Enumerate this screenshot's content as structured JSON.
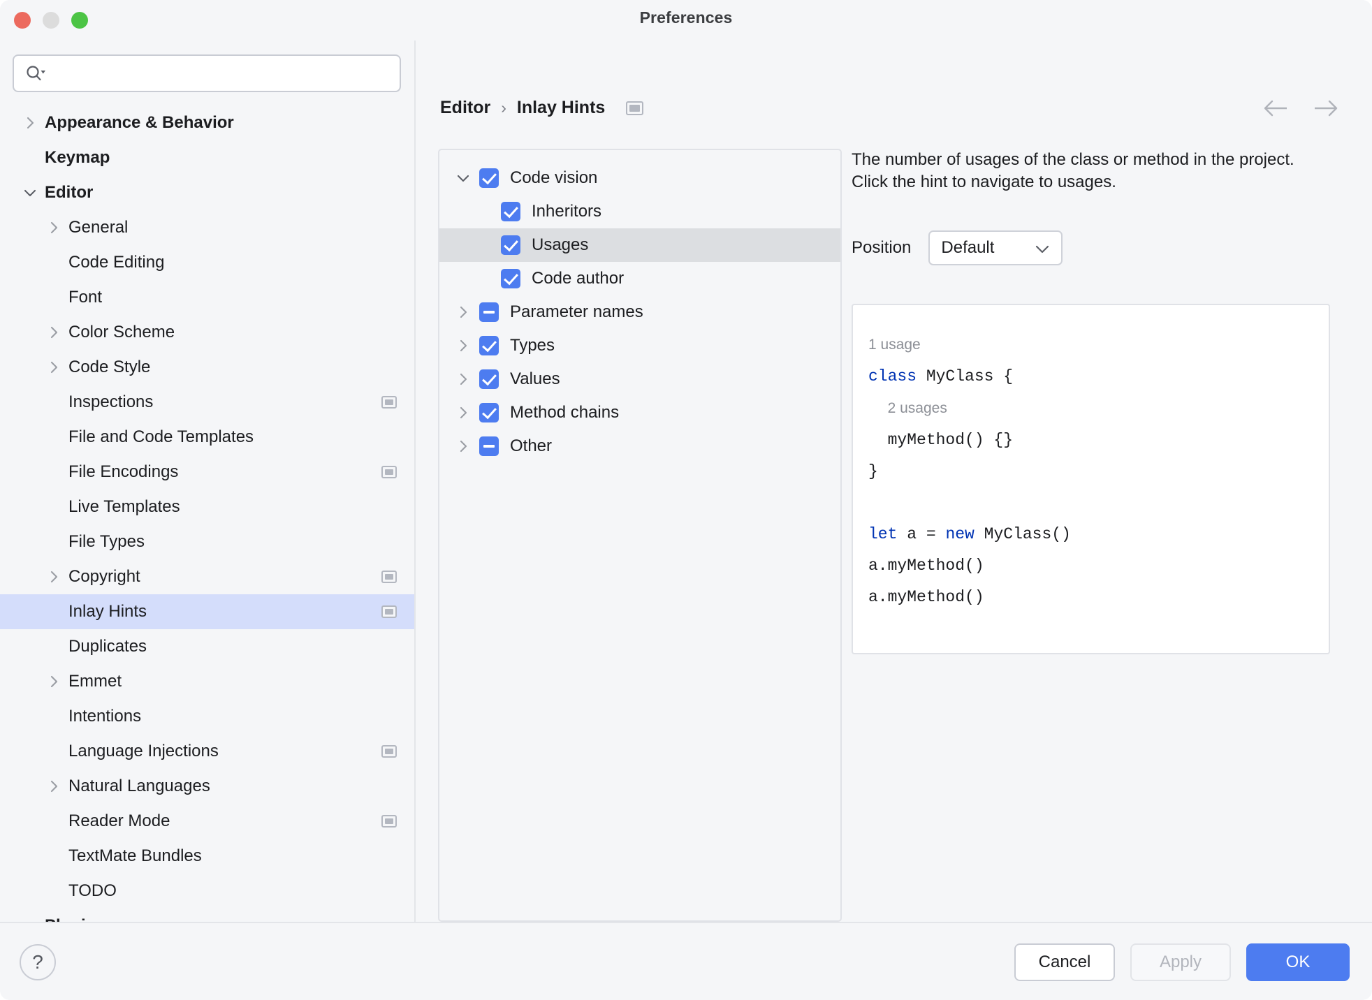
{
  "window": {
    "title": "Preferences",
    "traffic_lights": [
      "close-red",
      "minimize-yellow",
      "maximize-green"
    ]
  },
  "search": {
    "value": "",
    "placeholder": "",
    "icon": "search-icon"
  },
  "sidebar": {
    "items": [
      {
        "label": "Appearance & Behavior",
        "level": 0,
        "twisty": "right",
        "bold": true,
        "badge": false,
        "selected": false
      },
      {
        "label": "Keymap",
        "level": 0,
        "twisty": "none",
        "bold": true,
        "badge": false,
        "selected": false
      },
      {
        "label": "Editor",
        "level": 0,
        "twisty": "down",
        "bold": true,
        "badge": false,
        "selected": false
      },
      {
        "label": "General",
        "level": 1,
        "twisty": "right",
        "bold": false,
        "badge": false,
        "selected": false
      },
      {
        "label": "Code Editing",
        "level": 1,
        "twisty": "none",
        "bold": false,
        "badge": false,
        "selected": false
      },
      {
        "label": "Font",
        "level": 1,
        "twisty": "none",
        "bold": false,
        "badge": false,
        "selected": false
      },
      {
        "label": "Color Scheme",
        "level": 1,
        "twisty": "right",
        "bold": false,
        "badge": false,
        "selected": false
      },
      {
        "label": "Code Style",
        "level": 1,
        "twisty": "right",
        "bold": false,
        "badge": false,
        "selected": false
      },
      {
        "label": "Inspections",
        "level": 1,
        "twisty": "none",
        "bold": false,
        "badge": true,
        "selected": false
      },
      {
        "label": "File and Code Templates",
        "level": 1,
        "twisty": "none",
        "bold": false,
        "badge": false,
        "selected": false
      },
      {
        "label": "File Encodings",
        "level": 1,
        "twisty": "none",
        "bold": false,
        "badge": true,
        "selected": false
      },
      {
        "label": "Live Templates",
        "level": 1,
        "twisty": "none",
        "bold": false,
        "badge": false,
        "selected": false
      },
      {
        "label": "File Types",
        "level": 1,
        "twisty": "none",
        "bold": false,
        "badge": false,
        "selected": false
      },
      {
        "label": "Copyright",
        "level": 1,
        "twisty": "right",
        "bold": false,
        "badge": true,
        "selected": false
      },
      {
        "label": "Inlay Hints",
        "level": 1,
        "twisty": "none",
        "bold": false,
        "badge": true,
        "selected": true
      },
      {
        "label": "Duplicates",
        "level": 1,
        "twisty": "none",
        "bold": false,
        "badge": false,
        "selected": false
      },
      {
        "label": "Emmet",
        "level": 1,
        "twisty": "right",
        "bold": false,
        "badge": false,
        "selected": false
      },
      {
        "label": "Intentions",
        "level": 1,
        "twisty": "none",
        "bold": false,
        "badge": false,
        "selected": false
      },
      {
        "label": "Language Injections",
        "level": 1,
        "twisty": "none",
        "bold": false,
        "badge": true,
        "selected": false
      },
      {
        "label": "Natural Languages",
        "level": 1,
        "twisty": "right",
        "bold": false,
        "badge": false,
        "selected": false
      },
      {
        "label": "Reader Mode",
        "level": 1,
        "twisty": "none",
        "bold": false,
        "badge": true,
        "selected": false
      },
      {
        "label": "TextMate Bundles",
        "level": 1,
        "twisty": "none",
        "bold": false,
        "badge": false,
        "selected": false
      },
      {
        "label": "TODO",
        "level": 1,
        "twisty": "none",
        "bold": false,
        "badge": false,
        "selected": false
      },
      {
        "label": "Plugins",
        "level": 0,
        "twisty": "none",
        "bold": true,
        "badge": false,
        "selected": false
      }
    ]
  },
  "breadcrumb": {
    "parent": "Editor",
    "separator": "›",
    "current": "Inlay Hints",
    "badge_icon": "project-scope-badge-icon"
  },
  "nav": {
    "back_icon": "arrow-left-icon",
    "forward_icon": "arrow-right-icon"
  },
  "options_tree": {
    "items": [
      {
        "label": "Code vision",
        "depth": 0,
        "twisty": "down",
        "check": "checked",
        "selected": false
      },
      {
        "label": "Inheritors",
        "depth": 1,
        "twisty": "none",
        "check": "checked",
        "selected": false
      },
      {
        "label": "Usages",
        "depth": 1,
        "twisty": "none",
        "check": "checked",
        "selected": true
      },
      {
        "label": "Code author",
        "depth": 1,
        "twisty": "none",
        "check": "checked",
        "selected": false
      },
      {
        "label": "Parameter names",
        "depth": 0,
        "twisty": "right",
        "check": "indeterminate",
        "selected": false
      },
      {
        "label": "Types",
        "depth": 0,
        "twisty": "right",
        "check": "checked",
        "selected": false
      },
      {
        "label": "Values",
        "depth": 0,
        "twisty": "right",
        "check": "checked",
        "selected": false
      },
      {
        "label": "Method chains",
        "depth": 0,
        "twisty": "right",
        "check": "checked",
        "selected": false
      },
      {
        "label": "Other",
        "depth": 0,
        "twisty": "right",
        "check": "indeterminate",
        "selected": false
      }
    ]
  },
  "detail": {
    "description": "The number of usages of the class or method in the project. Click the hint to navigate to usages.",
    "position_label": "Position",
    "position_value": "Default",
    "position_options": [
      "Default"
    ],
    "dropdown_icon": "chevron-down-icon"
  },
  "code_preview": {
    "lines": [
      {
        "indent": 0,
        "type": "hint",
        "text": "1 usage"
      },
      {
        "indent": 0,
        "type": "code",
        "segments": [
          {
            "t": "class",
            "c": "kw"
          },
          {
            "t": " MyClass {",
            "c": ""
          }
        ]
      },
      {
        "indent": 1,
        "type": "hint",
        "text": "2 usages"
      },
      {
        "indent": 1,
        "type": "code",
        "segments": [
          {
            "t": "myMethod() {}",
            "c": ""
          }
        ]
      },
      {
        "indent": 0,
        "type": "code",
        "segments": [
          {
            "t": "}",
            "c": ""
          }
        ]
      },
      {
        "indent": 0,
        "type": "code",
        "segments": [
          {
            "t": " ",
            "c": ""
          }
        ]
      },
      {
        "indent": 0,
        "type": "code",
        "segments": [
          {
            "t": "let",
            "c": "kw"
          },
          {
            "t": " a = ",
            "c": ""
          },
          {
            "t": "new",
            "c": "kw"
          },
          {
            "t": " MyClass()",
            "c": ""
          }
        ]
      },
      {
        "indent": 0,
        "type": "code",
        "segments": [
          {
            "t": "a.myMethod()",
            "c": ""
          }
        ]
      },
      {
        "indent": 0,
        "type": "code",
        "segments": [
          {
            "t": "a.myMethod()",
            "c": ""
          }
        ]
      }
    ]
  },
  "footer": {
    "help_label": "?",
    "cancel_label": "Cancel",
    "apply_label": "Apply",
    "apply_disabled": true,
    "ok_label": "OK"
  },
  "colors": {
    "accent": "#4d7cf0",
    "sidebar_selection": "#d4ddfb",
    "tree_selection": "#dcdee1",
    "window_bg": "#f5f6f8",
    "keyword": "#0033b3",
    "hint_gray": "#8c8f96",
    "traffic_red": "#ec6a5e",
    "traffic_yellow": "#dcdcdc",
    "traffic_green": "#4cc445"
  }
}
